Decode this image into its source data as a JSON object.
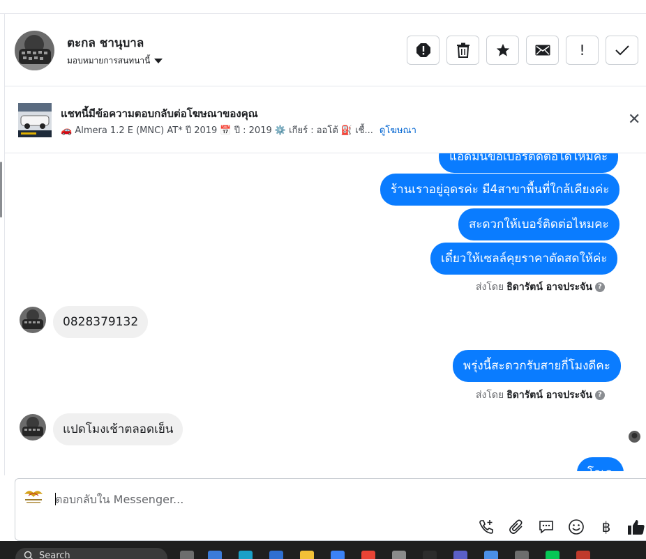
{
  "header": {
    "contact_name": "ตะกล ชานุบาล",
    "assign_label": "มอบหมายการสนทนานี้",
    "actions": [
      {
        "name": "spam",
        "icon": "alert-octagon-icon"
      },
      {
        "name": "delete",
        "icon": "trash-icon"
      },
      {
        "name": "star",
        "icon": "star-icon"
      },
      {
        "name": "mark-unread",
        "icon": "envelope-icon"
      },
      {
        "name": "follow-up",
        "icon": "exclamation-icon"
      },
      {
        "name": "done",
        "icon": "check-icon"
      }
    ]
  },
  "ad_banner": {
    "title": "แชทนี้มีข้อความตอบกลับต่อโฆษณาของคุณ",
    "description": "🚗 Almera 1.2 E (MNC) AT* ปี 2019 📅 ปี : 2019 ⚙️ เกียร์ : ออโต้ ⛽ เชื้...",
    "link": "ดูโฆษณา",
    "close_icon": "close-icon"
  },
  "messages": [
    {
      "direction": "outgoing",
      "text": "แอดมินขอเบอร์ติดต่อได้ไหมคะ"
    },
    {
      "direction": "outgoing",
      "text": "ร้านเราอยู่อุดรค่ะ มี4สาขาพื้นที่ใกล้เคียงค่ะ"
    },
    {
      "direction": "outgoing",
      "text": "สะดวกให้เบอร์ติดต่อไหมคะ"
    },
    {
      "direction": "outgoing",
      "text": "เดี๋ยวให้เซลล์คุยราคาตัดสดให้ค่ะ"
    },
    {
      "direction": "incoming",
      "text": "0828379132"
    },
    {
      "direction": "outgoing",
      "text": "พรุ่งนี้สะดวกรับสายกี่โมงดีคะ"
    },
    {
      "direction": "incoming",
      "text": "แปดโมงเช้าตลอดเย็น"
    },
    {
      "direction": "outgoing",
      "text": "โอเค"
    }
  ],
  "sent_by": {
    "prefix": "ส่งโดย",
    "name": "ธิดารัตน์ อาจประจัน"
  },
  "composer": {
    "placeholder": "ตอบกลับใน Messenger...",
    "tools": [
      "phone-plus-icon",
      "paperclip-icon",
      "comment-icon",
      "smiley-icon",
      "baht-icon",
      "thumbs-up-icon"
    ]
  },
  "taskbar": {
    "search_label": "Search"
  },
  "colors": {
    "outgoing_bubble": "#0a7cff",
    "incoming_bubble": "#f0f0f0",
    "link": "#0064d1"
  }
}
